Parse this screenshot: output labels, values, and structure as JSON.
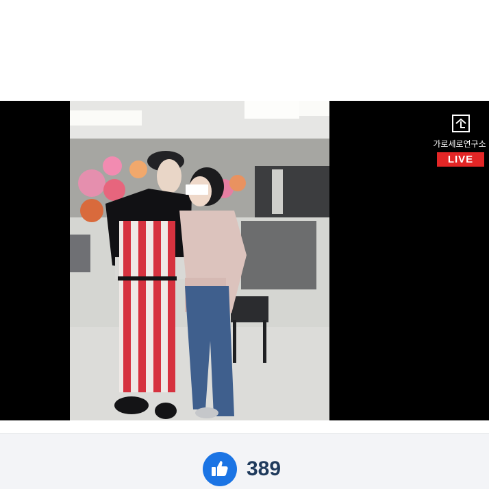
{
  "video": {
    "channel_name": "가로세로연구소",
    "live_label": "LIVE",
    "logo_icon": "house-arrow-icon",
    "accent_color": "#e32626"
  },
  "reactions": {
    "icon": "thumbs-up-icon",
    "like_count": "389",
    "icon_color": "#1b74e4"
  }
}
